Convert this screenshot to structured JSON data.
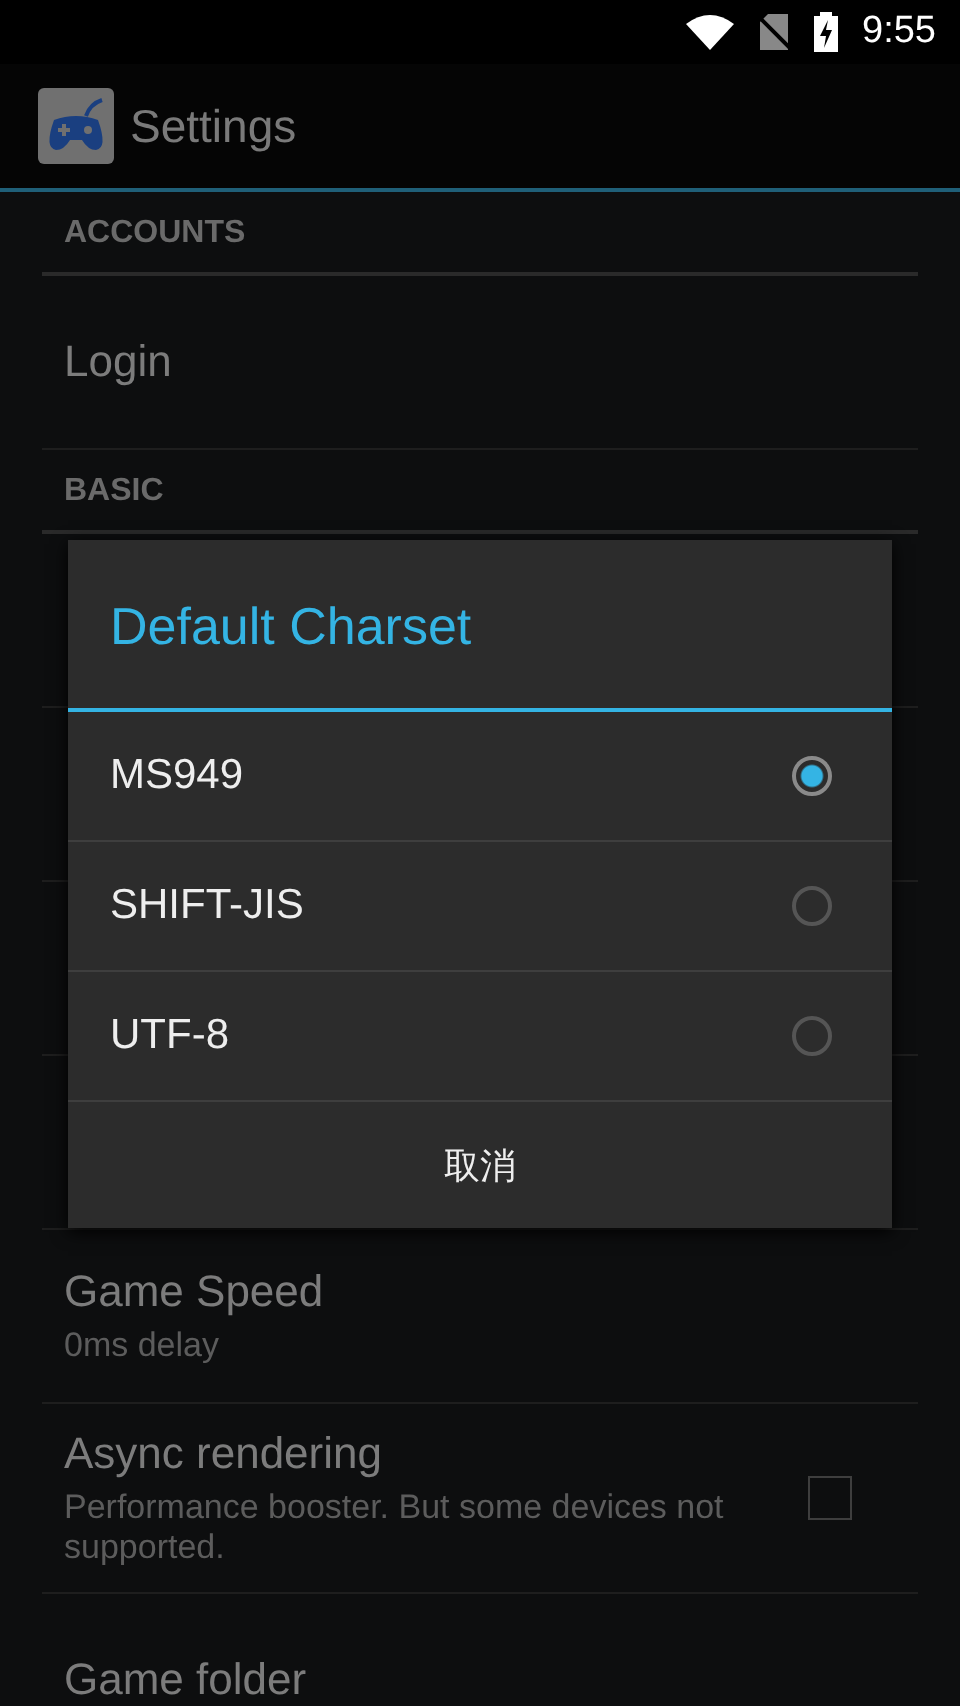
{
  "status_bar": {
    "time": "9:55"
  },
  "action_bar": {
    "title": "Settings"
  },
  "sections": [
    {
      "header": "ACCOUNTS",
      "items": [
        {
          "kind": "plain",
          "title": "Login"
        }
      ]
    },
    {
      "header": "BASIC",
      "items": [
        {
          "kind": "hidden"
        },
        {
          "kind": "hidden"
        },
        {
          "kind": "hidden"
        },
        {
          "kind": "hidden"
        },
        {
          "kind": "plain",
          "title": "Game Speed",
          "summary": "0ms delay"
        },
        {
          "kind": "checkbox",
          "title": "Async rendering",
          "summary": "Performance booster. But some devices not supported.",
          "checked": false
        },
        {
          "kind": "plain",
          "title": "Game folder"
        }
      ]
    }
  ],
  "dialog": {
    "title": "Default Charset",
    "options": [
      {
        "label": "MS949",
        "selected": true
      },
      {
        "label": "SHIFT-JIS",
        "selected": false
      },
      {
        "label": "UTF-8",
        "selected": false
      }
    ],
    "cancel": "取消"
  }
}
